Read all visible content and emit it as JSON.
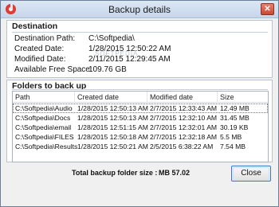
{
  "window": {
    "title": "Backup details",
    "icon": "app-swirl-icon",
    "close_label": "✕"
  },
  "destination": {
    "heading": "Destination",
    "fields": [
      {
        "label": "Destination Path:",
        "value": "C:\\Softpedia\\"
      },
      {
        "label": "Created Date:",
        "value": "1/28/2015 12:50:22 AM"
      },
      {
        "label": "Modified Date:",
        "value": "2/11/2015 12:29:45 AM"
      },
      {
        "label": "Available Free Space:",
        "value": "109.76  GB"
      }
    ],
    "watermark": "SOFTPEDIA"
  },
  "folders": {
    "heading": "Folders to back up",
    "columns": [
      "Path",
      "Created date",
      "Modified date",
      "Size"
    ],
    "rows": [
      [
        "C:\\Softpedia\\Audio",
        "1/28/2015 12:50:13 AM",
        "2/7/2015 12:33:43 AM",
        "12.49  MB"
      ],
      [
        "C:\\Softpedia\\Docs",
        "1/28/2015 12:50:13 AM",
        "2/7/2015 12:32:10 AM",
        "31.45  MB"
      ],
      [
        "C:\\Softpedia\\email",
        "1/28/2015 12:51:15 AM",
        "2/7/2015 12:32:01 AM",
        "30.19  KB"
      ],
      [
        "C:\\Softpedia\\FILES",
        "1/28/2015 12:50:18 AM",
        "2/7/2015 12:32:18 AM",
        "5.5  MB"
      ],
      [
        "C:\\Softpedia\\Results",
        "1/28/2015 12:50:21 AM",
        "2/5/2015 6:38:22 AM",
        "7.54  MB"
      ]
    ]
  },
  "footer": {
    "total_label": "Total backup folder size :",
    "total_value": "MB  57.02",
    "close_button": "Close"
  }
}
